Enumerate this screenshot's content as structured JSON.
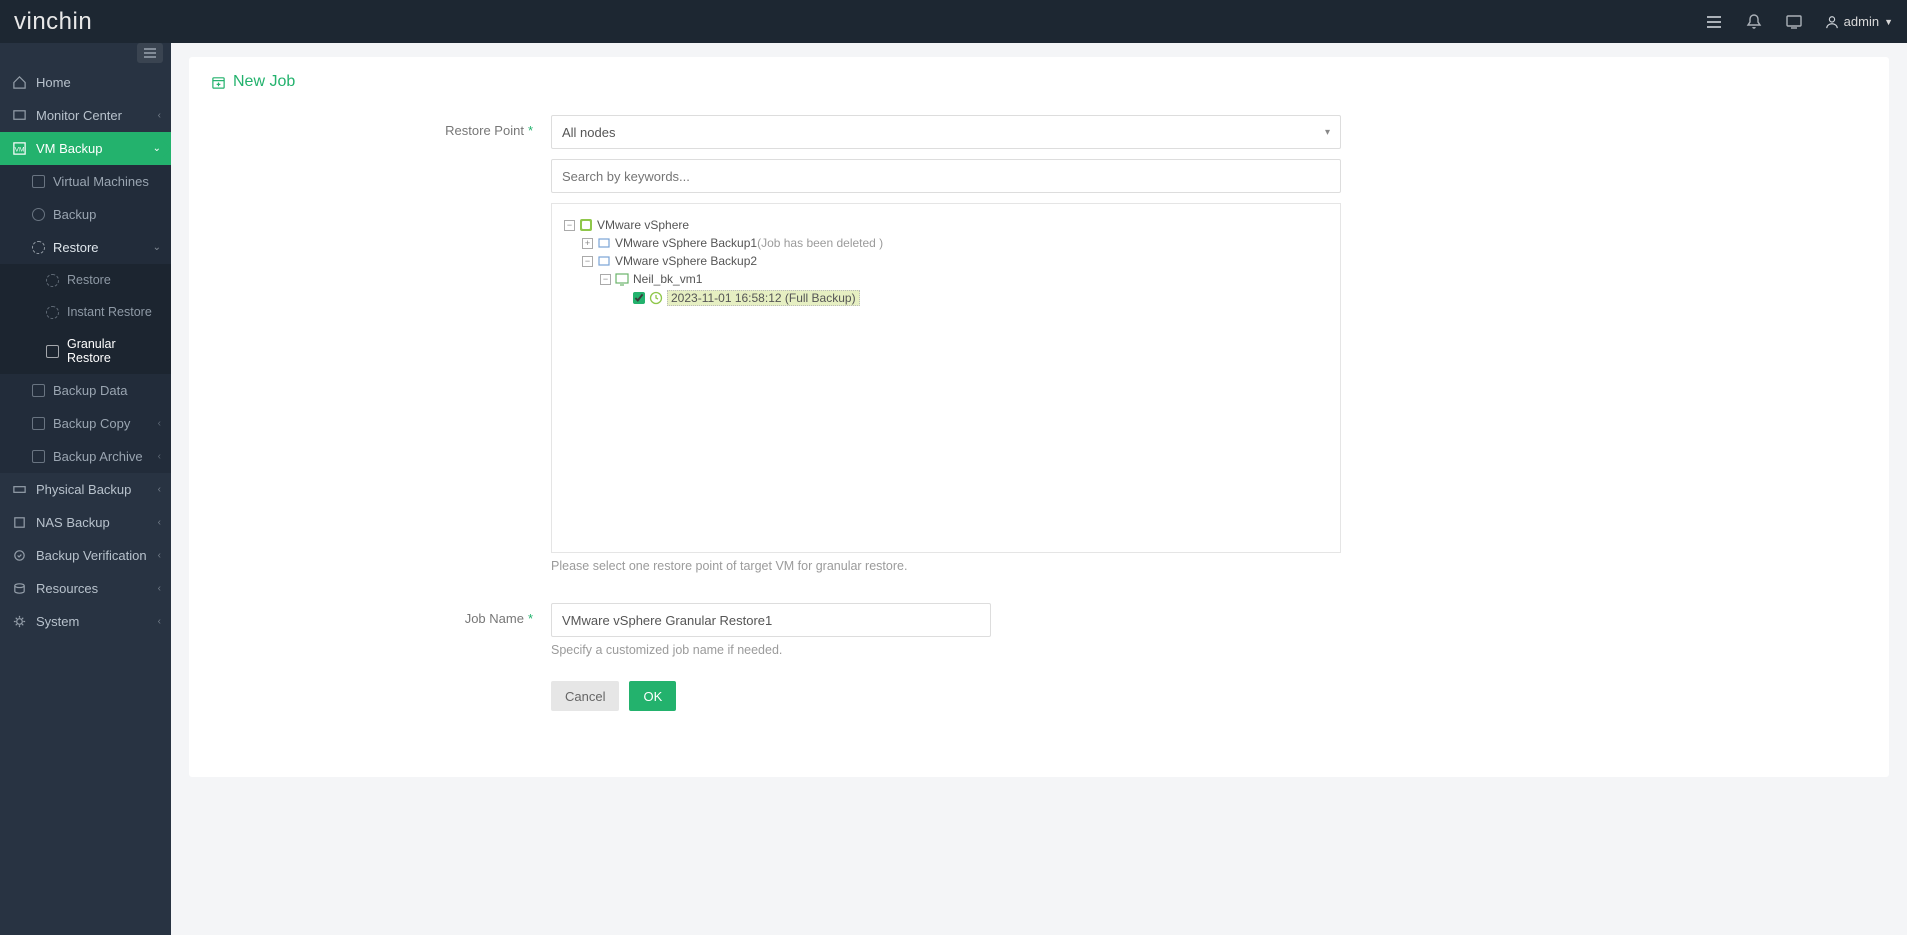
{
  "brand": "vinchin",
  "header": {
    "user": "admin"
  },
  "sidebar": {
    "items": [
      {
        "label": "Home"
      },
      {
        "label": "Monitor Center"
      },
      {
        "label": "VM Backup"
      },
      {
        "label": "Physical Backup"
      },
      {
        "label": "NAS Backup"
      },
      {
        "label": "Backup Verification"
      },
      {
        "label": "Resources"
      },
      {
        "label": "System"
      }
    ],
    "vm_backup": {
      "items": [
        {
          "label": "Virtual Machines"
        },
        {
          "label": "Backup"
        },
        {
          "label": "Restore"
        },
        {
          "label": "Backup Data"
        },
        {
          "label": "Backup Copy"
        },
        {
          "label": "Backup Archive"
        }
      ],
      "restore_sub": [
        {
          "label": "Restore"
        },
        {
          "label": "Instant Restore"
        },
        {
          "label": "Granular Restore"
        }
      ]
    }
  },
  "page": {
    "title": "New Job",
    "restore_point_label": "Restore Point",
    "nodes_select": "All nodes",
    "search_placeholder": "Search by keywords...",
    "tree": {
      "root": "VMware vSphere",
      "job1": "VMware vSphere Backup1",
      "job1_note": "(Job has been deleted )",
      "job2": "VMware vSphere Backup2",
      "vm": "Neil_bk_vm1",
      "rp": "2023-11-01 16:58:12 (Full  Backup)"
    },
    "restore_help": "Please select one restore point of target VM for granular restore.",
    "job_name_label": "Job Name",
    "job_name_value": "VMware vSphere Granular Restore1",
    "job_name_help": "Specify a customized job name if needed.",
    "cancel": "Cancel",
    "ok": "OK"
  }
}
